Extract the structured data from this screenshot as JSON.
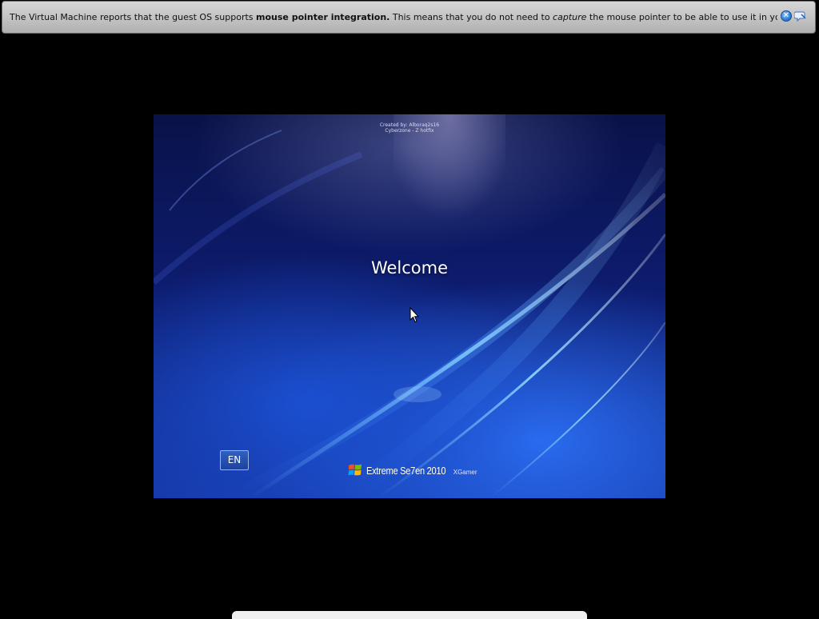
{
  "notification": {
    "text_before": "The Virtual Machine reports that the guest OS supports ",
    "text_bold": "mouse pointer integration.",
    "text_middle": " This means that you do not need to ",
    "text_italic": "capture",
    "text_after": " the mouse pointer to be able to use it in your guest OS -- all mouse",
    "close_icon": "close-icon",
    "hide_icon": "hide-message-icon",
    "close_glyph": "✕"
  },
  "guest": {
    "credit_line1": "Created by: Alboraq2s16",
    "credit_line2": "Cyberzone  - Z   hotfix",
    "welcome": "Welcome",
    "language_button": "EN",
    "brand_name": "Extreme Se7en 2010",
    "brand_sub": "XGamer"
  },
  "colors": {
    "screen_background": "#000000",
    "notice_background": "#c6c6c6",
    "accent_blue": "#1d43a0"
  }
}
